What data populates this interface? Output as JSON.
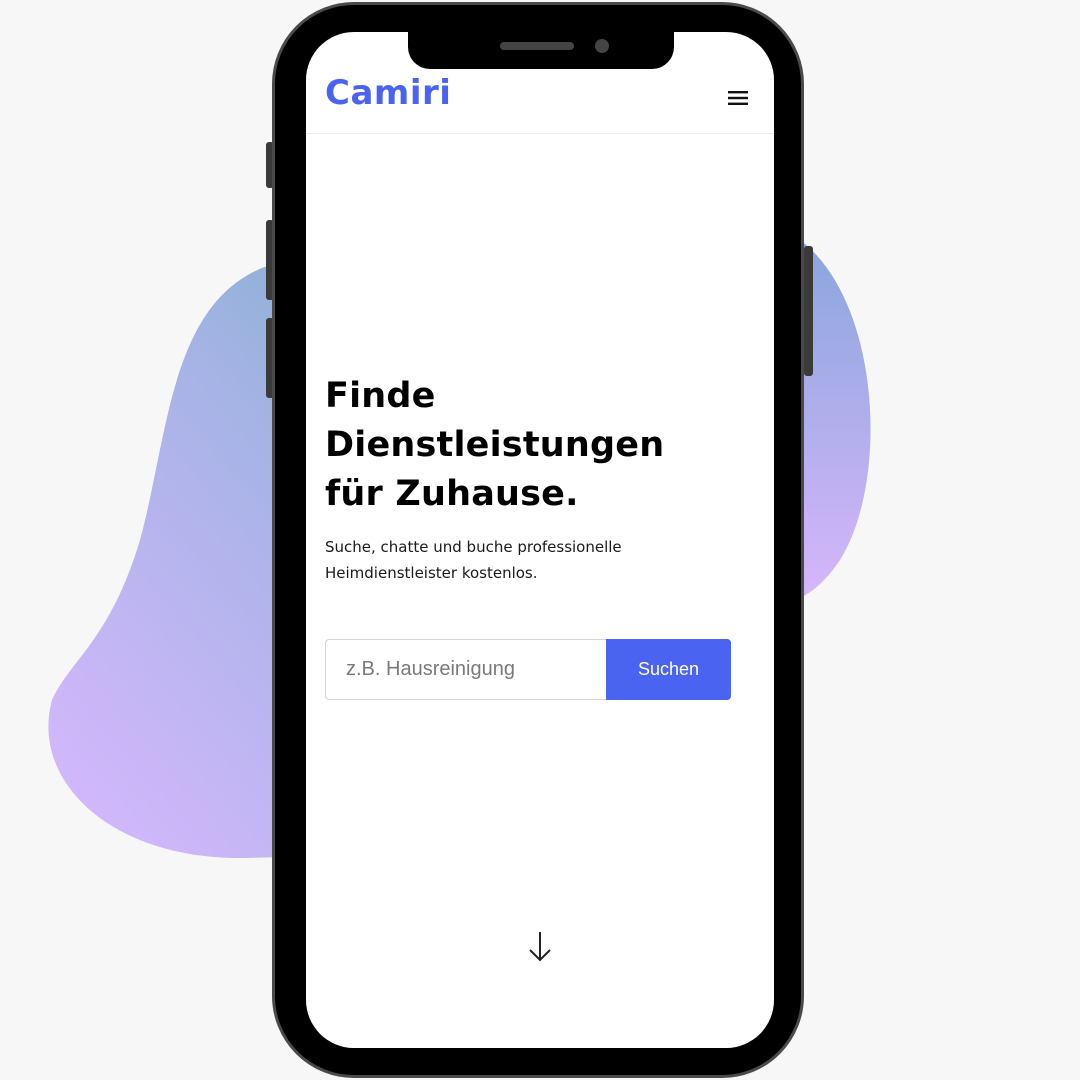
{
  "brand": {
    "logo_text": "Camiri",
    "accent_color": "#4a63f0"
  },
  "header": {
    "menu_icon": "hamburger-menu-icon"
  },
  "hero": {
    "title_lines": [
      "Finde",
      "Dienstleistungen",
      "für Zuhause."
    ],
    "subtitle_lines": [
      "Suche, chatte und buche professionelle",
      "Heimdienstleister kostenlos."
    ]
  },
  "search": {
    "value": "",
    "placeholder": "z.B. Hausreinigung",
    "button_label": "Suchen"
  },
  "scroll_indicator": {
    "icon": "arrow-down-icon"
  }
}
